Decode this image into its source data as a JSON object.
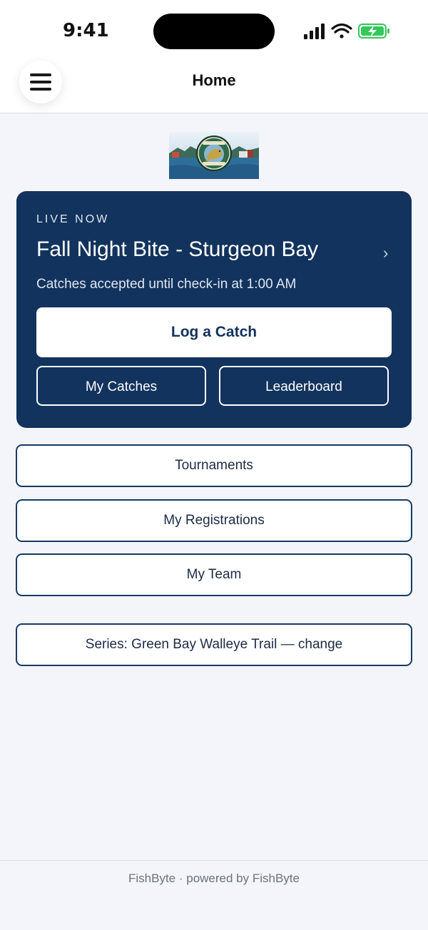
{
  "status": {
    "time": "9:41"
  },
  "header": {
    "title": "Home"
  },
  "logo": {
    "alt": "Green Bay Walleye Trail logo"
  },
  "live": {
    "label": "LIVE NOW",
    "title": "Fall Night Bite - Sturgeon Bay",
    "subtitle": "Catches accepted until check-in at 1:00 AM",
    "primary_action": "Log a Catch",
    "secondary_actions": [
      "My Catches",
      "Leaderboard"
    ],
    "chevron": "›"
  },
  "menu": {
    "items": [
      "Tournaments",
      "My Registrations",
      "My Team"
    ],
    "series": "Series: Green Bay Walleye Trail — change"
  },
  "footer": {
    "text": "FishByte · powered by FishByte"
  },
  "colors": {
    "primary": "#12335d",
    "background": "#f3f5fa",
    "battery": "#34c759"
  }
}
